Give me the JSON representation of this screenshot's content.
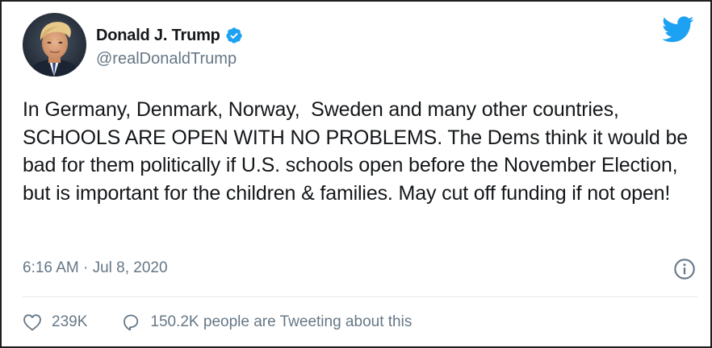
{
  "author": {
    "name": "Donald J. Trump",
    "handle": "@realDonaldTrump",
    "verified": true,
    "avatar_icon": "profile-photo"
  },
  "brand_icon": "twitter-bird-icon",
  "tweet": {
    "text": "In Germany, Denmark, Norway,  Sweden and many other countries, SCHOOLS ARE OPEN WITH NO PROBLEMS. The Dems think it would be bad for them politically if U.S. schools open before the November Election, but is important for the children & families. May cut off funding if not open!",
    "timestamp": "6:16 AM · Jul 8, 2020"
  },
  "actions": {
    "likes": "239K",
    "conversation": "150.2K people are Tweeting about this"
  },
  "colors": {
    "brand": "#1da1f2",
    "text_primary": "#14171a",
    "text_secondary": "#657786",
    "divider": "#e1e8ed",
    "border": "#1f1f1f"
  }
}
